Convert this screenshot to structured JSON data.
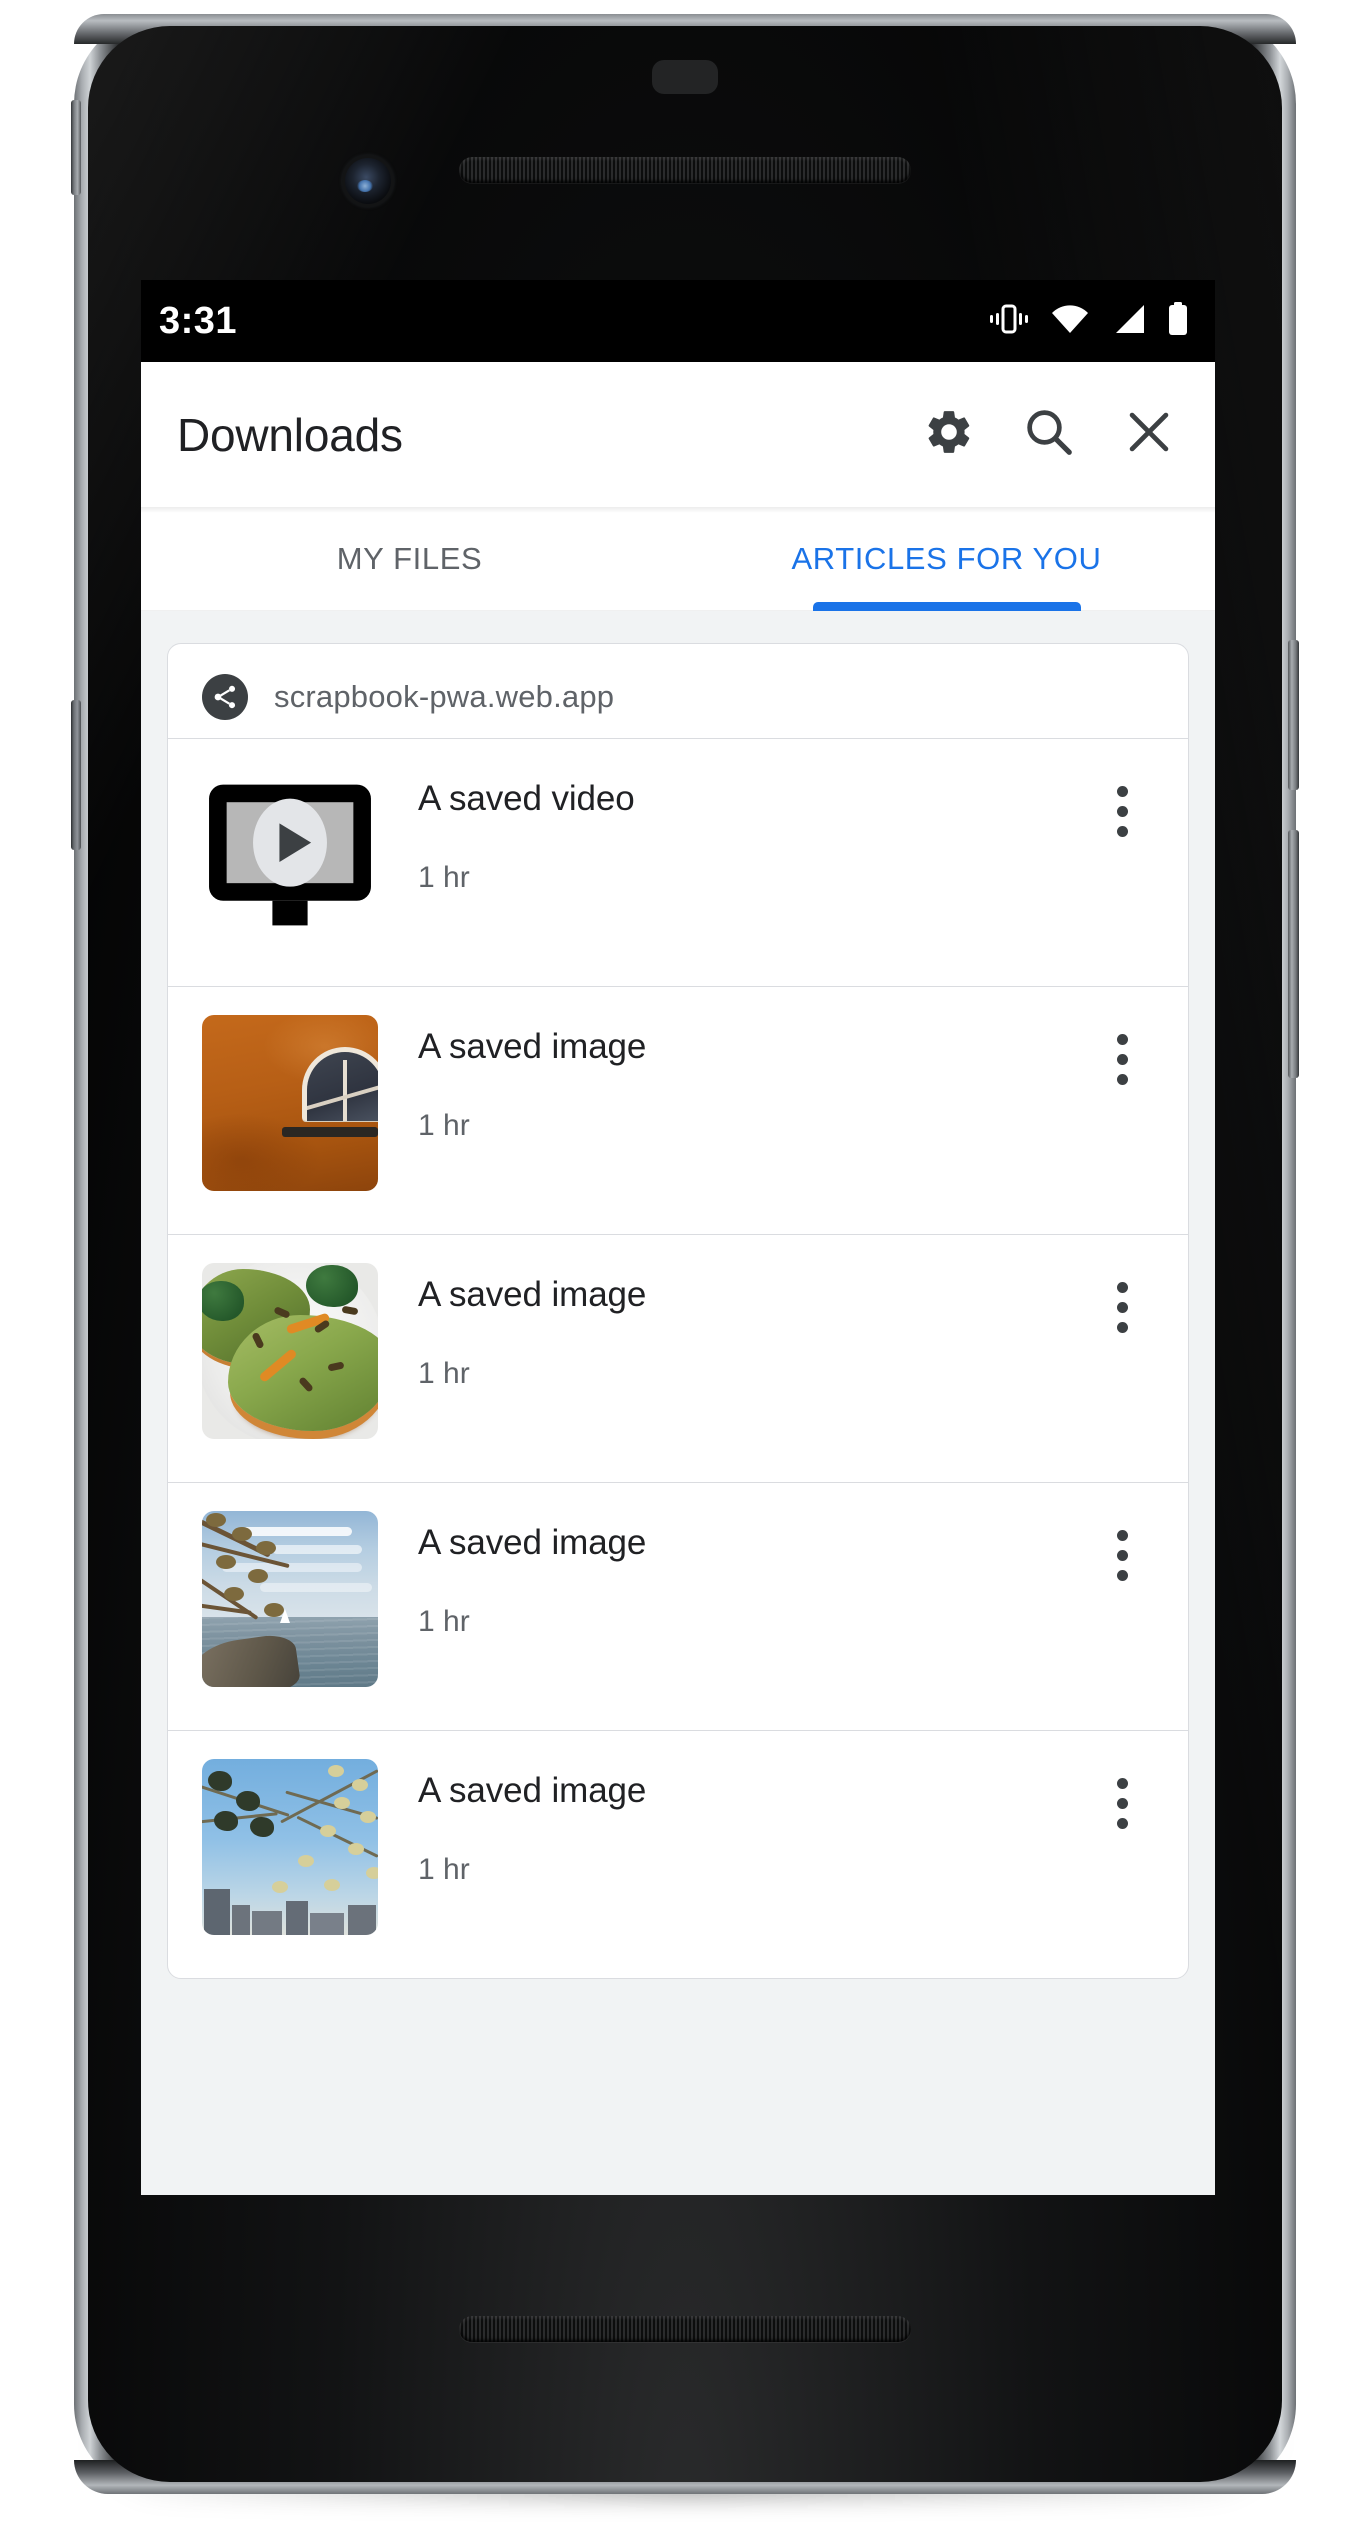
{
  "status_bar": {
    "clock": "3:31",
    "icons": [
      "vibrate-icon",
      "wifi-icon",
      "cell-signal-icon",
      "battery-icon"
    ]
  },
  "toolbar": {
    "title": "Downloads",
    "actions": [
      {
        "name": "settings-button",
        "icon": "gear-icon",
        "label": "Settings"
      },
      {
        "name": "search-button",
        "icon": "search-icon",
        "label": "Search"
      },
      {
        "name": "close-button",
        "icon": "close-icon",
        "label": "Close"
      }
    ]
  },
  "tabs": [
    {
      "label": "MY FILES",
      "active": false
    },
    {
      "label": "ARTICLES FOR YOU",
      "active": true
    }
  ],
  "colors": {
    "accent_blue": "#1a73e8",
    "text_primary": "#202124",
    "text_secondary": "#5f6368",
    "divider": "#dadce0",
    "page_background": "#f1f3f4",
    "status_bar_background": "#000000"
  },
  "card": {
    "origin": "scrapbook-pwa.web.app",
    "origin_icon": "share-icon",
    "items": [
      {
        "title": "A saved video",
        "age": "1 hr",
        "thumb": "video-placeholder-icon",
        "menu": "overflow-menu-icon"
      },
      {
        "title": "A saved image",
        "age": "1 hr",
        "thumb": "orange-wall-photo",
        "menu": "overflow-menu-icon"
      },
      {
        "title": "A saved image",
        "age": "1 hr",
        "thumb": "avocado-toast-photo",
        "menu": "overflow-menu-icon"
      },
      {
        "title": "A saved image",
        "age": "1 hr",
        "thumb": "lake-shore-photo",
        "menu": "overflow-menu-icon"
      },
      {
        "title": "A saved image",
        "age": "1 hr",
        "thumb": "city-skyline-photo",
        "menu": "overflow-menu-icon"
      }
    ]
  }
}
